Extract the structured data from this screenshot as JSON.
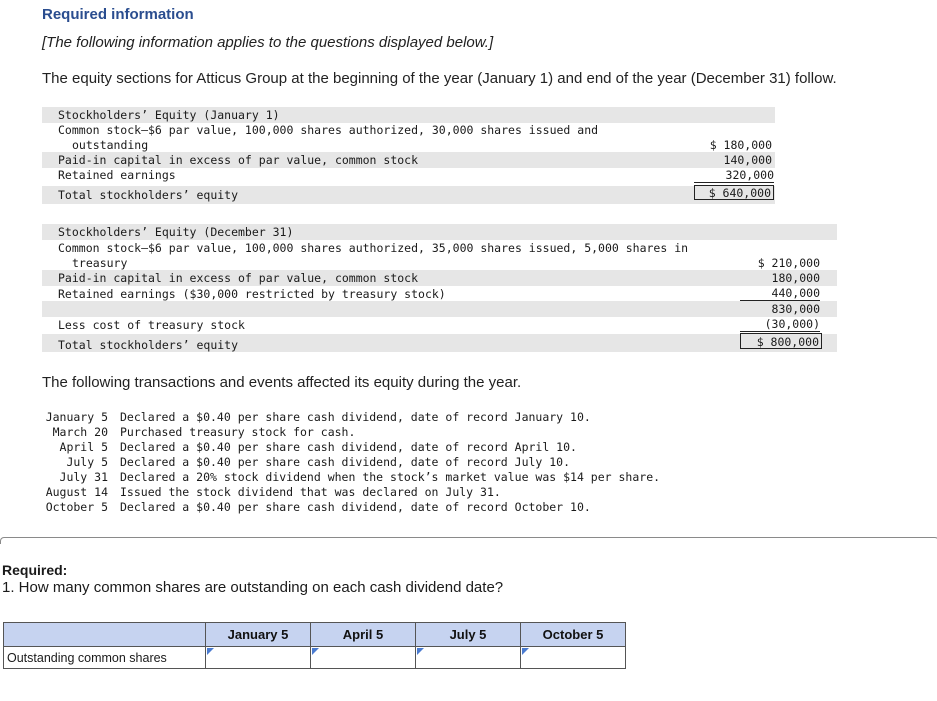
{
  "header": {
    "title": "Required information",
    "note": "[The following information applies to the questions displayed below.]",
    "intro": "The equity sections for Atticus Group at the beginning of the year (January 1) and end of the year (December 31) follow."
  },
  "jan1": {
    "heading": "Stockholders’ Equity (January 1)",
    "common_line1": "Common stock—$6 par value, 100,000 shares authorized, 30,000 shares issued and",
    "common_line2": "outstanding",
    "common_value": "$ 180,000",
    "paid_in_label": "Paid-in capital in excess of par value, common stock",
    "paid_in_value": "140,000",
    "retained_label": "Retained earnings",
    "retained_value": "320,000",
    "total_label": "Total stockholders’ equity",
    "total_value": "$ 640,000"
  },
  "dec31": {
    "heading": "Stockholders’ Equity (December 31)",
    "common_line1": "Common stock—$6 par value, 100,000 shares authorized, 35,000 shares issued, 5,000 shares in",
    "common_line2": "treasury",
    "common_value": "$ 210,000",
    "paid_in_label": "Paid-in capital in excess of par value, common stock",
    "paid_in_value": "180,000",
    "retained_label": "Retained earnings ($30,000 restricted by treasury stock)",
    "retained_value": "440,000",
    "subtotal_value": "830,000",
    "treasury_label": "Less cost of treasury stock",
    "treasury_value": "(30,000)",
    "total_label": "Total stockholders’ equity",
    "total_value": "$ 800,000"
  },
  "transactions": {
    "intro": "The following transactions and events affected its equity during the year.",
    "items": [
      {
        "date": "January 5",
        "text": "Declared a $0.40 per share cash dividend, date of record January 10."
      },
      {
        "date": "March 20",
        "text": "Purchased treasury stock for cash."
      },
      {
        "date": "April 5",
        "text": "Declared a $0.40 per share cash dividend, date of record April 10."
      },
      {
        "date": "July 5",
        "text": "Declared a $0.40 per share cash dividend, date of record July 10."
      },
      {
        "date": "July 31",
        "text": "Declared a 20% stock dividend when the stock’s market value was $14 per share."
      },
      {
        "date": "August 14",
        "text": "Issued the stock dividend that was declared on July 31."
      },
      {
        "date": "October 5",
        "text": "Declared a $0.40 per share cash dividend, date of record October 10."
      }
    ]
  },
  "question": {
    "required_label": "Required:",
    "text": "1. How many common shares are outstanding on each cash dividend date?"
  },
  "answer_table": {
    "columns": [
      "January 5",
      "April 5",
      "July 5",
      "October 5"
    ],
    "row_label": "Outstanding common shares",
    "values": [
      "",
      "",
      "",
      ""
    ]
  }
}
